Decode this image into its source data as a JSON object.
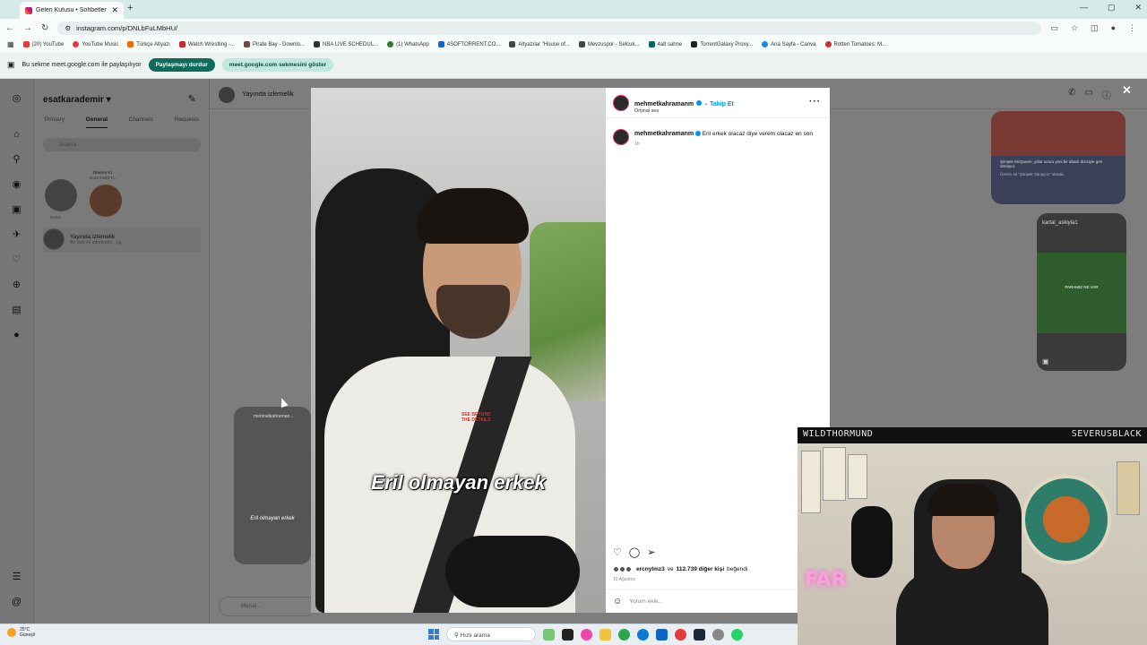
{
  "browser": {
    "tab_title": "Gelen Kutusu • Sohbetler",
    "tab_close": "✕",
    "new_tab": "+",
    "url": "instagram.com/p/DNLbFuLMbHU/",
    "window_controls": [
      "—",
      "▢",
      "✕"
    ]
  },
  "bookmarks": [
    {
      "label": "(20) YouTube",
      "color": "#e53935"
    },
    {
      "label": "YouTube Music",
      "color": "#e53935"
    },
    {
      "label": "Türkçe Altyazı",
      "color": "#ef6c00"
    },
    {
      "label": "Watch Wrestling -...",
      "color": "#c62828"
    },
    {
      "label": "Pirate Bay - Downlo...",
      "color": "#6d4c41"
    },
    {
      "label": "NBA LIVE SCHEDUL...",
      "color": "#333333"
    },
    {
      "label": "(1) WhatsApp",
      "color": "#2e7d32"
    },
    {
      "label": "4SOFTORRENT.CO...",
      "color": "#1565c0"
    },
    {
      "label": "Altyazılar \"House of...",
      "color": "#444444"
    },
    {
      "label": "Mevzuspor - Selcuk...",
      "color": "#444444"
    },
    {
      "label": "4alt sahne",
      "color": "#00695c"
    },
    {
      "label": "TorrentGalaxy Proxy...",
      "color": "#222222"
    },
    {
      "label": "Ana Sayfa - Canva",
      "color": "#1e88e5"
    },
    {
      "label": "Rotten Tomatoes: M...",
      "color": "#d32f2f"
    }
  ],
  "sharebar": {
    "message": "Bu sekme meet.google.com ile paylaşılıyor",
    "stop_button": "Paylaşmayı durdur",
    "show_button": "meet.google.com sekmesini göster"
  },
  "dm": {
    "username": "esatkarademir",
    "tabs": [
      "Primary",
      "General",
      "Channels",
      "Requests"
    ],
    "active_tab": "General",
    "search_placeholder": "Arama",
    "note_text": "Dilerim Ki",
    "note_sub": "Dora Kaleli Ti...",
    "note_user": "Notun",
    "thread_name": "Yayında izlemelik",
    "thread_preview": "Bir ekip ek gönderdin · 1g",
    "chat_title": "Yayında izlemelik",
    "message_placeholder": "Mesaj..."
  },
  "chat_cards": {
    "card1_text": "Şimşek McQueen, yıllar sonra yeni bir abartı dizisiyle geri dönüyor.",
    "card1_sub": "Üzerin ait \"Şimşek Yarışçısı\" olacak.",
    "card2_user": "kartal_askiyla1",
    "card2_caption": "PARAMIZ NE VAR",
    "card3_user": "mehmetkahraman...",
    "card3_caption": "Eril olmayan erkek"
  },
  "post": {
    "author": "mehmetkahramanm",
    "follow_label": "Takip Et",
    "bullet": "•",
    "audio": "Orijinal ses",
    "caption": "Eril erkek olacaz diye verem olacaz en son",
    "caption_time": "1h",
    "liked_by_user": "ercnylmz3",
    "liked_by_connector": "ve",
    "liked_count": "112.739 diğer kişi",
    "liked_suffix": "beğendi",
    "date": "10 Ağustos",
    "comment_placeholder": "Yorum ekle...",
    "video_caption": "Eril olmayan erkek",
    "shirt_text": "SEE BEYOND THE DETAILS",
    "more": "···",
    "close": "✕"
  },
  "webcam": {
    "left_name": "WILDTHORMUND",
    "right_name": "SEVERUSBLACK",
    "neon_text": "FAR"
  },
  "taskbar": {
    "temp": "25°C",
    "condition": "Güneşli",
    "search_placeholder": "Hızlı arama"
  },
  "icons": {
    "rail": [
      "instagram-logo-icon",
      "home-icon",
      "search-icon",
      "explore-icon",
      "reels-icon",
      "messages-icon",
      "notifications-icon",
      "create-icon",
      "dashboard-icon",
      "profile-icon",
      "menu-icon",
      "threads-icon"
    ],
    "accent": "#0095f6",
    "share_dark": "#0f6b5c"
  }
}
